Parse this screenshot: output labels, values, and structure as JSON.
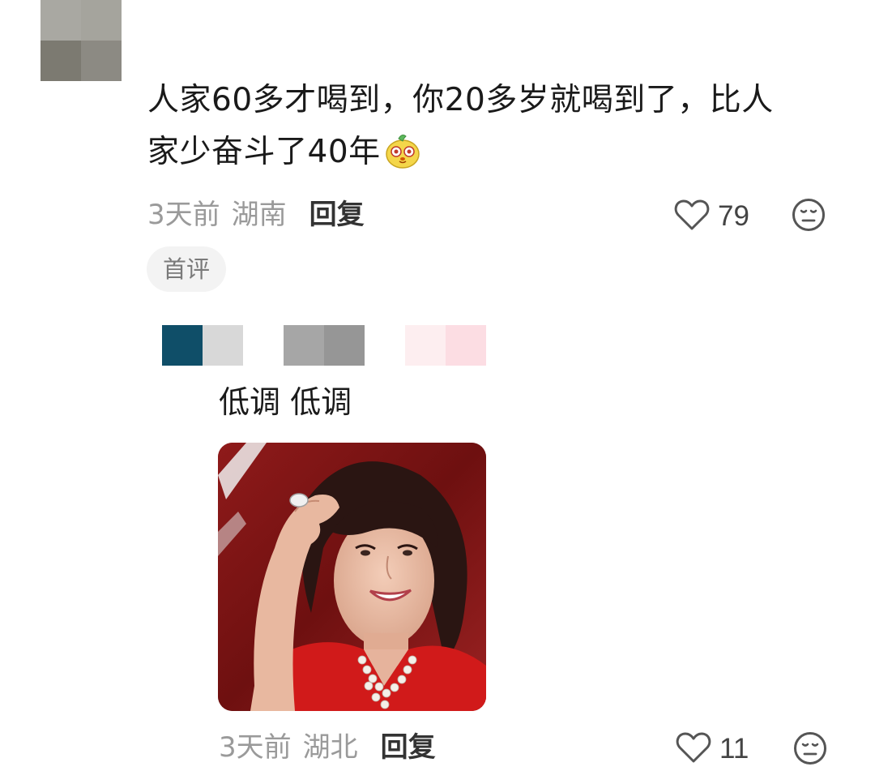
{
  "comment": {
    "text_line1": "人家60多才喝到，你20多岁就喝到了，比人",
    "text_line2": "家少奋斗了40年",
    "emoji_icon": "yellow-mascot-emoji-icon",
    "time": "3天前",
    "location": "湖南",
    "reply_label": "回复",
    "like_count": "79",
    "badge": "首评",
    "avatar_colors": [
      "#a9a8a2",
      "#a5a49d",
      "#7c7a71",
      "#8c8a83"
    ]
  },
  "reply": {
    "text": "低调 低调",
    "time": "3天前",
    "location": "湖北",
    "reply_label": "回复",
    "like_count": "11",
    "avatar_colors": [
      "#0f4e68",
      "#d8d8d8",
      "#a6a6a6",
      "#969696",
      "#fdeef0",
      "#fcdde3"
    ],
    "image_icon": "woman-in-red-photo"
  },
  "icons": {
    "like": "heart-outline-icon",
    "dislike": "meh-face-icon"
  }
}
